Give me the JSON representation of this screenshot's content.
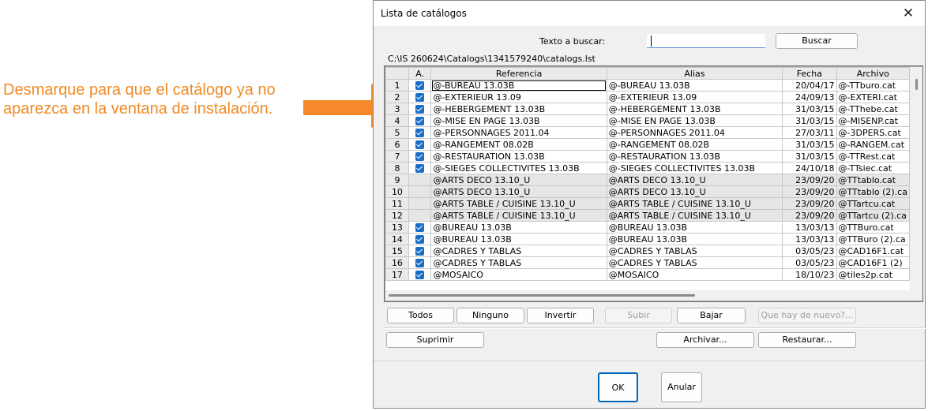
{
  "annotation": {
    "text": "Desmarque para que el catálogo ya no aparezca en la ventana de instalación.",
    "color": "#f08a24"
  },
  "dialog": {
    "title": "Lista de catálogos",
    "close_icon": "close-icon",
    "search_label": "Texto a buscar:",
    "search_value": "",
    "search_button": "Buscar",
    "path": "C:\\IS 260624\\Catalogs\\1341579240\\catalogs.lst",
    "columns": {
      "num": "",
      "active": "A.",
      "reference": "Referencia",
      "alias": "Alias",
      "date": "Fecha",
      "file": "Archivo"
    },
    "rows": [
      {
        "n": "1",
        "checked": true,
        "ref": "@-BUREAU 13.03B",
        "alias": "@-BUREAU 13.03B",
        "date": "20/04/17",
        "file": "@-TTburo.cat",
        "gray": false
      },
      {
        "n": "2",
        "checked": true,
        "ref": "@-EXTERIEUR 13.09",
        "alias": "@-EXTERIEUR 13.09",
        "date": "24/09/13",
        "file": "@-EXTERI.cat",
        "gray": false
      },
      {
        "n": "3",
        "checked": true,
        "ref": "@-HEBERGEMENT 13.03B",
        "alias": "@-HEBERGEMENT 13.03B",
        "date": "31/03/15",
        "file": "@-TThebe.cat",
        "gray": false
      },
      {
        "n": "4",
        "checked": true,
        "ref": "@-MISE EN PAGE 13.03B",
        "alias": "@-MISE EN PAGE 13.03B",
        "date": "31/03/15",
        "file": "@-MISENP.cat",
        "gray": false
      },
      {
        "n": "5",
        "checked": true,
        "ref": "@-PERSONNAGES 2011.04",
        "alias": "@-PERSONNAGES 2011.04",
        "date": "27/03/11",
        "file": "@-3DPERS.cat",
        "gray": false
      },
      {
        "n": "6",
        "checked": true,
        "ref": "@-RANGEMENT 08.02B",
        "alias": "@-RANGEMENT 08.02B",
        "date": "31/03/15",
        "file": "@-RANGEM.cat",
        "gray": false
      },
      {
        "n": "7",
        "checked": true,
        "ref": "@-RESTAURATION 13.03B",
        "alias": "@-RESTAURATION 13.03B",
        "date": "31/03/15",
        "file": "@-TTRest.cat",
        "gray": false
      },
      {
        "n": "8",
        "checked": true,
        "ref": "@-SIEGES COLLECTIVITES 13.03B",
        "alias": "@-SIEGES COLLECTIVITES 13.03B",
        "date": "24/10/18",
        "file": "@-TTsiec.cat",
        "gray": false
      },
      {
        "n": "9",
        "checked": false,
        "ref": "@ARTS DECO 13.10_U",
        "alias": "@ARTS DECO 13.10_U",
        "date": "23/09/20",
        "file": "@TTtablo.cat",
        "gray": true
      },
      {
        "n": "10",
        "checked": false,
        "ref": "@ARTS DECO 13.10_U",
        "alias": "@ARTS DECO 13.10_U",
        "date": "23/09/20",
        "file": "@TTtablo (2).ca",
        "gray": true
      },
      {
        "n": "11",
        "checked": false,
        "ref": "@ARTS TABLE / CUISINE 13.10_U",
        "alias": "@ARTS TABLE / CUISINE 13.10_U",
        "date": "23/09/20",
        "file": "@TTartcu.cat",
        "gray": true
      },
      {
        "n": "12",
        "checked": false,
        "ref": "@ARTS TABLE / CUISINE 13.10_U",
        "alias": "@ARTS TABLE / CUISINE 13.10_U",
        "date": "23/09/20",
        "file": "@TTartcu (2).ca",
        "gray": true
      },
      {
        "n": "13",
        "checked": true,
        "ref": "@BUREAU 13.03B",
        "alias": "@BUREAU 13.03B",
        "date": "13/03/13",
        "file": "@TTBuro.cat",
        "gray": false
      },
      {
        "n": "14",
        "checked": true,
        "ref": "@BUREAU 13.03B",
        "alias": "@BUREAU 13.03B",
        "date": "13/03/13",
        "file": "@TTBuro (2).ca",
        "gray": false
      },
      {
        "n": "15",
        "checked": true,
        "ref": "@CADRES Y TABLAS",
        "alias": "@CADRES Y TABLAS",
        "date": "03/05/23",
        "file": "@CAD16F1.cat",
        "gray": false
      },
      {
        "n": "16",
        "checked": true,
        "ref": "@CADRES Y TABLAS",
        "alias": "@CADRES Y TABLAS",
        "date": "03/05/23",
        "file": "@CAD16F1 (2)",
        "gray": false
      },
      {
        "n": "17",
        "checked": true,
        "ref": "@MOSAICO",
        "alias": "@MOSAICO",
        "date": "18/10/23",
        "file": "@tiles2p.cat",
        "gray": false
      }
    ],
    "buttons": {
      "all": "Todos",
      "none": "Ninguno",
      "invert": "Invertir",
      "up": "Subir",
      "down": "Bajar",
      "whats_new": "Que hay de nuevo?...",
      "delete": "Suprimir",
      "archive": "Archivar...",
      "restore": "Restaurar...",
      "ok": "OK",
      "cancel": "Anular"
    }
  }
}
